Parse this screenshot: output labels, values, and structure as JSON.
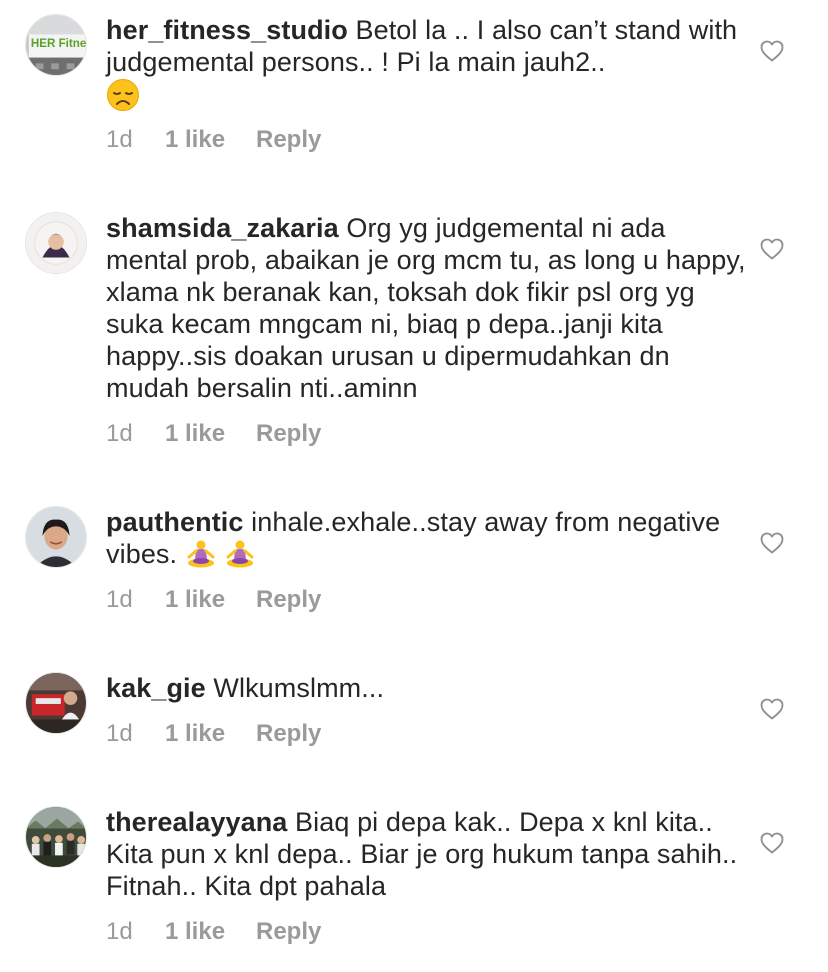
{
  "comments": [
    {
      "username": "her_fitness_studio",
      "text": " Betol la .. I also can’t stand with judgemental persons.. ! Pi la main jauh2..",
      "emoji": "disappointed-face",
      "time": "1d",
      "likes": "1 like",
      "reply": "Reply",
      "avatar_label": "HER Fitness"
    },
    {
      "username": "shamsida_zakaria",
      "text": " Org yg judgemental ni ada mental prob, abaikan je org mcm tu, as long u happy, xlama nk beranak kan, toksah dok fikir psl org yg suka kecam mngcam ni, biaq p depa..janji kita happy..sis doakan urusan u dipermudahkan dn mudah bersalin nti..aminn",
      "time": "1d",
      "likes": "1 like",
      "reply": "Reply"
    },
    {
      "username": "pauthentic",
      "text": " inhale.exhale..stay away from negative vibes. ",
      "emoji": "person-in-lotus-position",
      "time": "1d",
      "likes": "1 like",
      "reply": "Reply"
    },
    {
      "username": "kak_gie",
      "text": " Wlkumslmm...",
      "time": "1d",
      "likes": "1 like",
      "reply": "Reply"
    },
    {
      "username": "therealayyana",
      "text": " Biaq pi depa kak.. Depa x knl kita.. Kita pun x knl depa.. Biar je org hukum tanpa sahih.. Fitnah.. Kita dpt pahala",
      "time": "1d",
      "likes": "1 like",
      "reply": "Reply"
    }
  ],
  "icons": {
    "like": "heart-outline-icon"
  },
  "colors": {
    "text": "#262626",
    "meta": "#9a9a9a",
    "heart": "#8e8e8e"
  }
}
